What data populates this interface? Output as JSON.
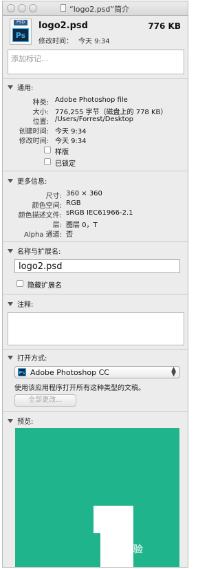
{
  "window": {
    "title": "“logo2.psd”简介"
  },
  "header": {
    "icon_tag": "PSD",
    "icon_glyph": "Ps",
    "file_name": "logo2.psd",
    "file_size": "776 KB",
    "modified_label": "修改时间：",
    "modified_value": "今天 9:34"
  },
  "tags": {
    "placeholder": "添加标记..."
  },
  "general": {
    "heading": "通用:",
    "rows": [
      {
        "label": "种类:",
        "value": "Adobe Photoshop file"
      },
      {
        "label": "大小:",
        "value": "776,255 字节（磁盘上的 778 KB）"
      },
      {
        "label": "位置:",
        "value": "/Users/Forrest/Desktop"
      },
      {
        "label": "创建时间:",
        "value": "今天 9:34"
      },
      {
        "label": "修改时间:",
        "value": "今天 9:34"
      }
    ],
    "stationery_label": "样版",
    "locked_label": "已锁定",
    "stationery_checked": false,
    "locked_checked": false
  },
  "more_info": {
    "heading": "更多信息:",
    "rows": [
      {
        "label": "尺寸:",
        "value": "360 × 360"
      },
      {
        "label": "颜色空间:",
        "value": "RGB"
      },
      {
        "label": "颜色描述文件:",
        "value": "sRGB IEC61966-2.1"
      },
      {
        "label": "层:",
        "value": "图层 0，T"
      },
      {
        "label": "Alpha 通道:",
        "value": "否"
      }
    ]
  },
  "name_ext": {
    "heading": "名称与扩展名:",
    "name_value": "logo2.psd",
    "hide_ext_label": "隐藏扩展名",
    "hide_ext_checked": false
  },
  "comments": {
    "heading": "注释:"
  },
  "open_with": {
    "heading": "打开方式:",
    "app_glyph": "Ps",
    "app_name": "Adobe Photoshop CC",
    "description": "使用该应用程序打开所有这种类型的文稿。",
    "change_all_label": "全部更改..."
  },
  "preview": {
    "heading": "预览:",
    "background_color": "#1fb48b"
  },
  "watermark": {
    "text": "Bai 经验"
  }
}
